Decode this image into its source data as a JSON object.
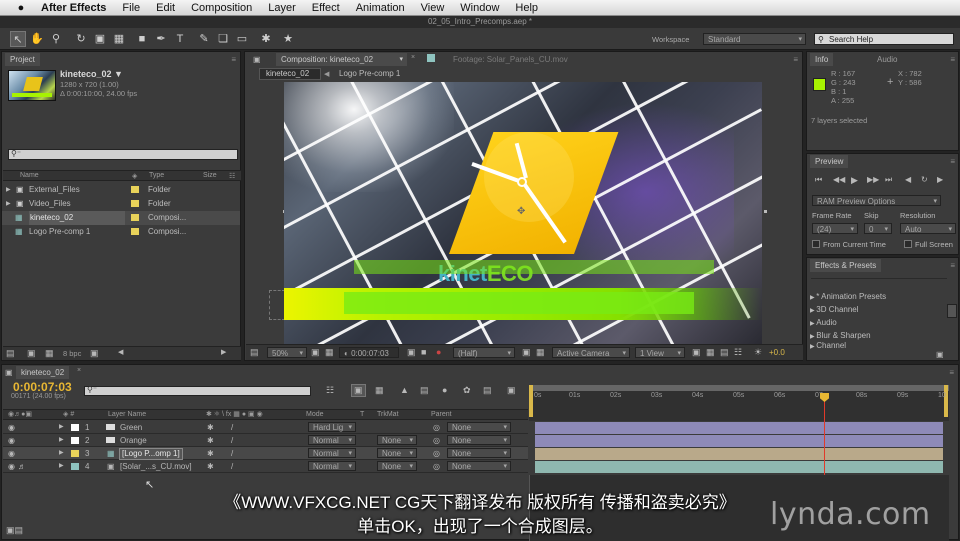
{
  "menubar": {
    "app": "After Effects",
    "items": [
      "File",
      "Edit",
      "Composition",
      "Layer",
      "Effect",
      "Animation",
      "View",
      "Window",
      "Help"
    ],
    "time": "",
    "status_icons": [
      "screen-icon",
      "volume-icon",
      "spotlight-icon"
    ]
  },
  "titlestrip": {
    "title": "02_05_Intro_Precomps.aep *"
  },
  "toolbar": {
    "workspace_label": "Workspace",
    "workspace_value": "Standard",
    "search_placeholder": "Search Help"
  },
  "project": {
    "tab": "Project",
    "item_name": "kineteco_02 ▼",
    "item_info1": "1280 x 720 (1.00)",
    "item_info2": "Δ 0:00:10:00, 24.00 fps",
    "col_name": "Name",
    "col_type": "Type",
    "col_size": "Size",
    "items": [
      {
        "name": "External_Files",
        "type": "Folder",
        "color": "#e8d25a"
      },
      {
        "name": "Video_Files",
        "type": "Folder",
        "color": "#e8d25a"
      },
      {
        "name": "kineteco_02",
        "type": "Composi...",
        "color": "#e8d25a"
      },
      {
        "name": "Logo Pre-comp 1",
        "type": "Composi...",
        "color": "#e8d25a"
      }
    ],
    "bpc": "8 bpc"
  },
  "composition": {
    "tab": "Composition: kineteco_02",
    "footage_tab": "Footage: Solar_Panels_CU.mov",
    "subtabs": [
      "kineteco_02",
      "Logo Pre-comp 1"
    ],
    "logo_text_a": "kinet",
    "logo_text_b": "ECO",
    "zoom": "50%",
    "timecode": "0:00:07:03",
    "resolution": "(Half)",
    "camera": "Active Camera",
    "view": "1 View",
    "exposure": "+0.0"
  },
  "info": {
    "tab": "Info",
    "tab2": "Audio",
    "r": "R : 167",
    "g": "G : 243",
    "b": "B : 1",
    "a": "A : 255",
    "x": "X : 782",
    "y": "Y : 586",
    "selected": "7 layers selected",
    "swatch": "#a7f301"
  },
  "preview": {
    "tab": "Preview",
    "ram": "RAM Preview Options",
    "frame_rate_label": "Frame Rate",
    "skip_label": "Skip",
    "resolution_label": "Resolution",
    "frame_rate": "(24)",
    "skip": "0",
    "resolution": "Auto",
    "from_current": "From Current Time",
    "full_screen": "Full Screen"
  },
  "effects": {
    "tab": "Effects & Presets",
    "items": [
      "* Animation Presets",
      "3D Channel",
      "Audio",
      "Blur & Sharpen",
      "Channel"
    ]
  },
  "timeline": {
    "tab": "kineteco_02",
    "timecode": "0:00:07:03",
    "frames": "00171 (24.00 fps)",
    "col_layer": "Layer Name",
    "col_mode": "Mode",
    "col_t": "T",
    "col_trkmat": "TrkMat",
    "col_parent": "Parent",
    "ruler": [
      "0s",
      "01s",
      "02s",
      "03s",
      "04s",
      "05s",
      "06s",
      "07s",
      "08s",
      "09s",
      "10"
    ],
    "layers": [
      {
        "num": "1",
        "name": "Green",
        "mode": "Hard Lig",
        "trkmat": "",
        "parent": "None",
        "color": "#ffffff",
        "bar": "#8e8ab8"
      },
      {
        "num": "2",
        "name": "Orange",
        "mode": "Normal",
        "trkmat": "None",
        "parent": "None",
        "color": "#ffffff",
        "bar": "#8e8ab8"
      },
      {
        "num": "3",
        "name": "[Logo P...omp 1]",
        "mode": "Normal",
        "trkmat": "None",
        "parent": "None",
        "color": "#e8d25a",
        "bar": "#b9a98a"
      },
      {
        "num": "4",
        "name": "[Solar_...s_CU.mov]",
        "mode": "Normal",
        "trkmat": "None",
        "parent": "None",
        "color": "#8fc4c0",
        "bar": "#8fb8b0"
      }
    ]
  },
  "captions": {
    "line1": "《WWW.VFXCG.NET CG天下翻译发布 版权所有 传播和盗卖必究》",
    "line2": "单击OK，出现了一个合成图层。"
  },
  "watermark": "lynda.com"
}
